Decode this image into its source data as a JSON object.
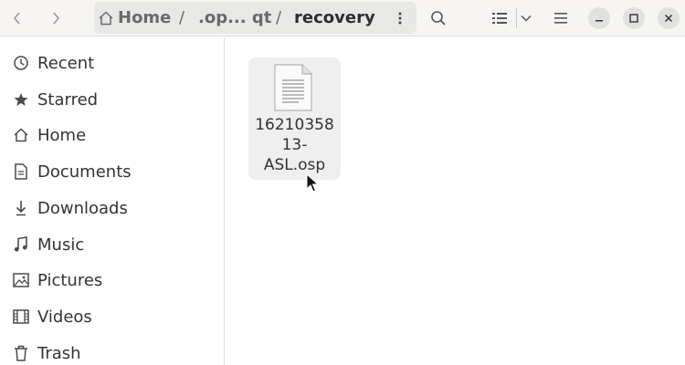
{
  "header": {
    "breadcrumb_home": "Home",
    "breadcrumb_sep": "/",
    "breadcrumb_middle": ".op... qt",
    "breadcrumb_current": "recovery",
    "icons": [
      "go-back-icon",
      "go-forward-icon",
      "home-icon",
      "path-menu-icon",
      "search-icon",
      "list-view-icon",
      "view-options-chevron-icon",
      "main-menu-icon",
      "minimize-icon",
      "maximize-icon",
      "close-icon"
    ]
  },
  "sidebar": {
    "items": [
      {
        "label": "Recent",
        "icon": "clock-icon"
      },
      {
        "label": "Starred",
        "icon": "star-icon"
      },
      {
        "label": "Home",
        "icon": "home-icon"
      },
      {
        "label": "Documents",
        "icon": "document-icon"
      },
      {
        "label": "Downloads",
        "icon": "download-icon"
      },
      {
        "label": "Music",
        "icon": "music-note-icon"
      },
      {
        "label": "Pictures",
        "icon": "picture-icon"
      },
      {
        "label": "Videos",
        "icon": "film-icon"
      },
      {
        "label": "Trash",
        "icon": "trash-icon"
      }
    ]
  },
  "files": [
    {
      "name_line1": "16210358",
      "name_line2": "13-",
      "name_line3": "ASL.osp",
      "icon": "text-document-icon"
    }
  ],
  "colors": {
    "headerbar": "#f6f5f4",
    "pathbar": "#e8e8e7",
    "selection": "#efefef"
  }
}
